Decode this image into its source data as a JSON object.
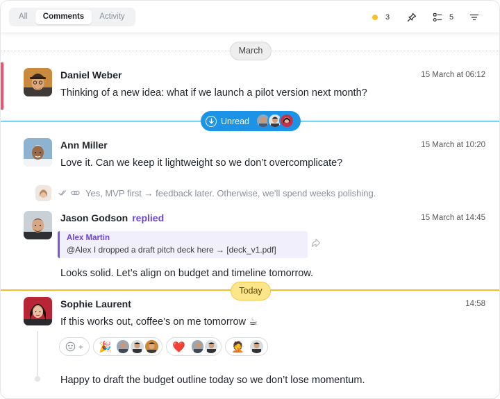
{
  "tabs": [
    {
      "label": "All",
      "active": false
    },
    {
      "label": "Comments",
      "active": true
    },
    {
      "label": "Activity",
      "active": false
    }
  ],
  "toolbar": {
    "status_count": "3",
    "status_color": "#f6c12b",
    "pin_icon": "pin-icon",
    "tasks_count": "5",
    "tasks_icon": "checklist-icon",
    "filter_icon": "filter-icon"
  },
  "dividers": {
    "march": "March",
    "today": "Today",
    "unread": "Unread"
  },
  "messages": [
    {
      "author": "Daniel Weber",
      "time": "15 March at 06:12",
      "text": "Thinking of a new idea: what if we launch a pilot version next month?"
    },
    {
      "author": "Ann Miller",
      "time": "15 March at 10:20",
      "text": "Love it. Can we keep it lightweight so we don’t overcomplicate?"
    },
    {
      "author": "Jason Godson",
      "action": "replied",
      "time": "15 March at 14:45",
      "quote_author": "Alex Martin",
      "quote_text": "@Alex I dropped a draft pitch deck here → [deck_v1.pdf]",
      "text": "Looks solid. Let’s align on budget and timeline tomorrow."
    },
    {
      "author": "Sophie Laurent",
      "time": "14:58",
      "text": "If this works out, coffee’s on me tomorrow ☕",
      "followup": "Happy to draft the budget outline today so we don’t lose momentum."
    }
  ],
  "thread_reply": {
    "text": "Yes, MVP first → feedback later. Otherwise, we’ll spend weeks polishing."
  },
  "reactions": {
    "add_label": "+",
    "items": [
      {
        "emoji": "🎉",
        "icon": "party-popper-icon"
      },
      {
        "emoji": "❤️",
        "icon": "heart-icon"
      },
      {
        "emoji": "🤦",
        "icon": "facepalm-icon"
      }
    ]
  },
  "colors": {
    "accent_red": "#f0526a",
    "unread_blue": "#1d93e8",
    "today_yellow": "#f4c12a",
    "replied_purple": "#6b44d6"
  }
}
